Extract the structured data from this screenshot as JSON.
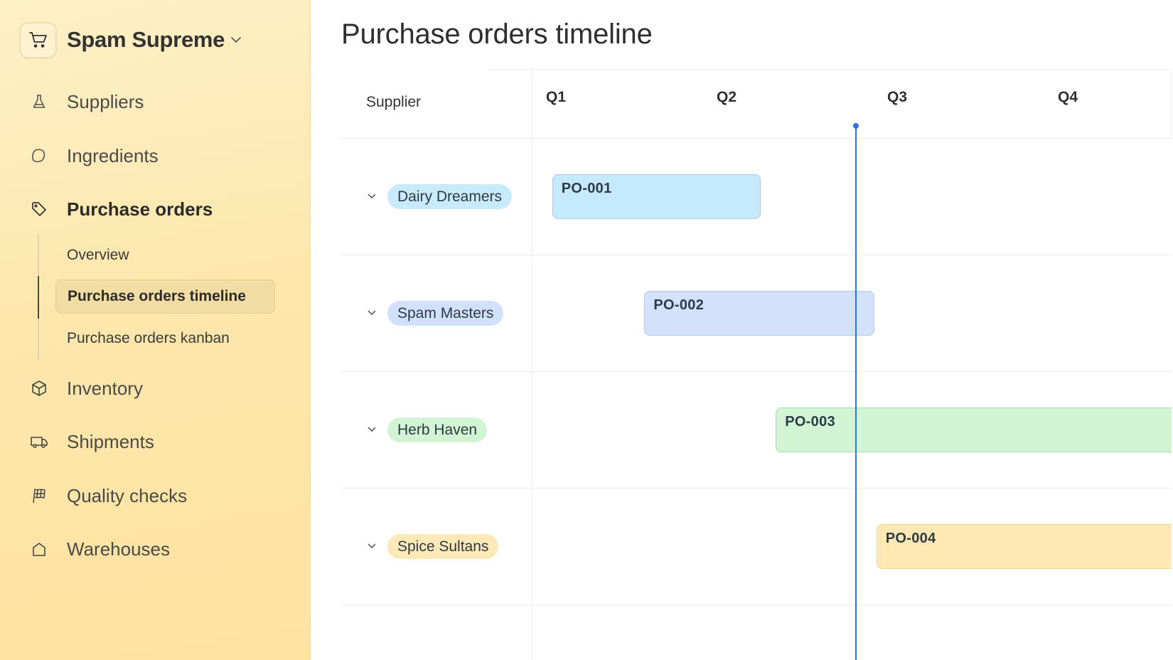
{
  "sidebar": {
    "brand": "Spam Supreme",
    "items": [
      {
        "label": "Suppliers",
        "icon": "flask-icon"
      },
      {
        "label": "Ingredients",
        "icon": "lemon-icon"
      },
      {
        "label": "Purchase orders",
        "icon": "tag-icon",
        "expanded": true
      },
      {
        "label": "Inventory",
        "icon": "box-icon"
      },
      {
        "label": "Shipments",
        "icon": "truck-icon"
      },
      {
        "label": "Quality checks",
        "icon": "checkered-flag-icon"
      },
      {
        "label": "Warehouses",
        "icon": "home-icon"
      }
    ],
    "sub_items": [
      {
        "label": "Overview",
        "active": false
      },
      {
        "label": "Purchase orders timeline",
        "active": true
      },
      {
        "label": "Purchase orders kanban",
        "active": false
      }
    ]
  },
  "main": {
    "title": "Purchase orders timeline",
    "column_header": "Supplier"
  },
  "chart_data": {
    "type": "gantt",
    "title": "Purchase orders timeline",
    "xlabel": "",
    "ylabel": "Supplier",
    "x_unit": "quarter",
    "x_ticks": [
      "Q1",
      "Q2",
      "Q3",
      "Q4"
    ],
    "x_range": [
      0,
      4
    ],
    "today_marker": 1.9,
    "rows": [
      {
        "supplier": "Dairy Dreamers",
        "pill_color": "#c7ebfc",
        "orders": [
          {
            "id": "PO-001",
            "start": 0.12,
            "end": 1.34,
            "fill": "#c6eafd",
            "border": "#a9c9ef"
          }
        ]
      },
      {
        "supplier": "Spam Masters",
        "pill_color": "#d2e1fb",
        "orders": [
          {
            "id": "PO-002",
            "start": 0.66,
            "end": 2.01,
            "fill": "#d3e1fb",
            "border": "#b4c8ee"
          }
        ]
      },
      {
        "supplier": "Herb Haven",
        "pill_color": "#d0f4d4",
        "orders": [
          {
            "id": "PO-003",
            "start": 1.43,
            "end": 4.0,
            "fill": "#d1f5d3",
            "border": "#a7dcac"
          }
        ]
      },
      {
        "supplier": "Spice Sultans",
        "pill_color": "#fde9b7",
        "orders": [
          {
            "id": "PO-004",
            "start": 2.02,
            "end": 4.0,
            "fill": "#fee9b5",
            "border": "#f0d58f"
          }
        ]
      }
    ],
    "colors": {
      "today_line": "#2f74e0"
    }
  }
}
